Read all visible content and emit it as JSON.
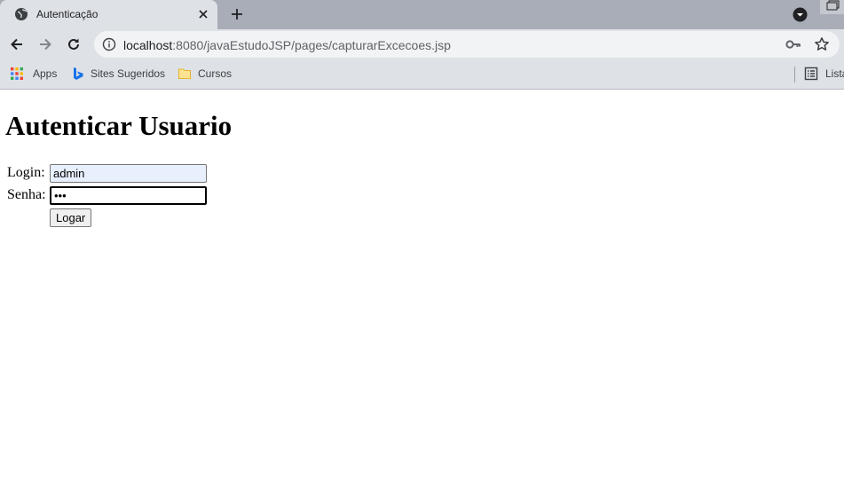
{
  "browser": {
    "tab": {
      "title": "Autenticação"
    },
    "address_bar": {
      "host": "localhost",
      "path": ":8080/javaEstudoJSP/pages/capturarExcecoes.jsp"
    },
    "bookmarks": [
      {
        "label": "Apps",
        "icon": "apps-grid-icon"
      },
      {
        "label": "Sites Sugeridos",
        "icon": "bing-icon"
      },
      {
        "label": "Cursos",
        "icon": "folder-icon"
      },
      {
        "label": "Lista",
        "icon": "reading-list-icon"
      }
    ]
  },
  "page": {
    "title": "Autenticar Usuario",
    "form": {
      "login_label": "Login:",
      "login_value": "admin",
      "senha_label": "Senha:",
      "senha_value": "•••",
      "submit_label": "Logar"
    }
  },
  "colors": {
    "tabstrip": "#a9adb7",
    "toolbar": "#dee1e6",
    "omnibox": "#f1f3f4",
    "autofill_bg": "#e8f0fe"
  }
}
